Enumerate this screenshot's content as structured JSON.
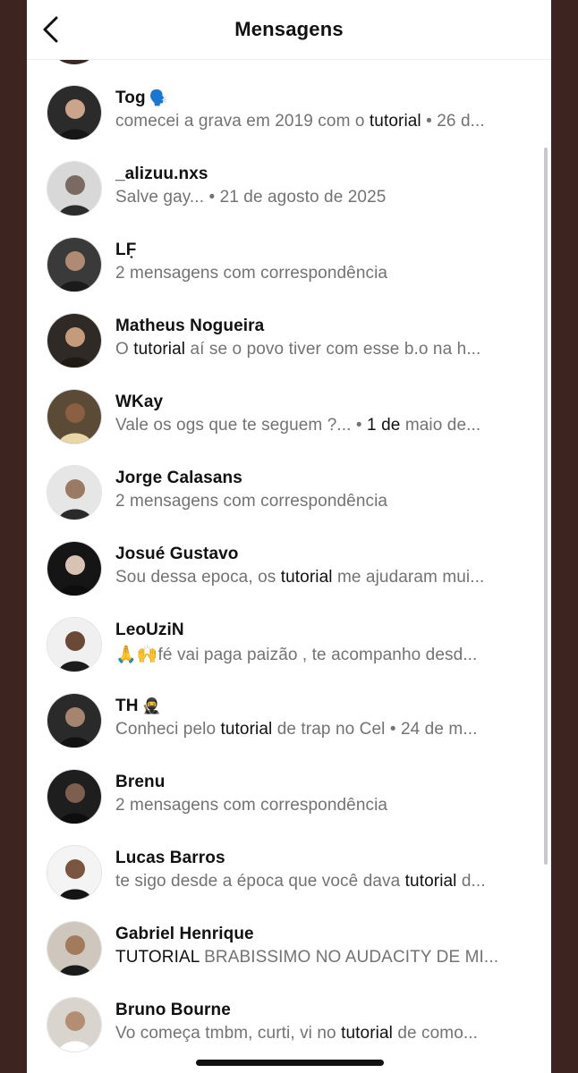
{
  "header": {
    "title": "Mensagens",
    "back_icon": "chevron-left-icon"
  },
  "conversations": [
    {
      "name": "Tog",
      "name_emoji": "🗣️",
      "preview": [
        {
          "t": "comecei a grava em 2019 com o ",
          "h": false
        },
        {
          "t": "tutorial",
          "h": true
        },
        {
          "t": " • 26 d...",
          "h": false
        }
      ]
    },
    {
      "name": "_alizuu.nxs",
      "name_emoji": "",
      "preview": [
        {
          "t": "Salve gay... • 21 de agosto de 2025",
          "h": false
        }
      ]
    },
    {
      "name": "LF̣",
      "name_emoji": "",
      "preview": [
        {
          "t": "2 mensagens com correspondência",
          "h": false
        }
      ]
    },
    {
      "name": "Matheus Nogueira",
      "name_emoji": "",
      "preview": [
        {
          "t": "O ",
          "h": false
        },
        {
          "t": "tutorial",
          "h": true
        },
        {
          "t": " aí se o povo tiver com esse b.o na h...",
          "h": false
        }
      ]
    },
    {
      "name": "WKay",
      "name_emoji": "",
      "preview": [
        {
          "t": "Vale os ogs que te seguem ?... • ",
          "h": false
        },
        {
          "t": "1 de",
          "h": true
        },
        {
          "t": " maio de...",
          "h": false
        }
      ]
    },
    {
      "name": "Jorge Calasans",
      "name_emoji": "",
      "preview": [
        {
          "t": "2 mensagens com correspondência",
          "h": false
        }
      ]
    },
    {
      "name": "Josué Gustavo",
      "name_emoji": "",
      "preview": [
        {
          "t": "Sou dessa epoca, os ",
          "h": false
        },
        {
          "t": "tutorial",
          "h": true
        },
        {
          "t": " me ajudaram mui...",
          "h": false
        }
      ]
    },
    {
      "name": "LeoUziN",
      "name_emoji": "",
      "preview": [
        {
          "t": "🙏🙌fé vai paga paizão , te acompanho desd...",
          "h": false
        }
      ]
    },
    {
      "name": "TH",
      "name_emoji": "🥷",
      "preview": [
        {
          "t": "Conheci pelo ",
          "h": false
        },
        {
          "t": "tutorial",
          "h": true
        },
        {
          "t": " de trap no Cel • 24 de m...",
          "h": false
        }
      ]
    },
    {
      "name": "Brenu",
      "name_emoji": "",
      "preview": [
        {
          "t": "2 mensagens com correspondência",
          "h": false
        }
      ]
    },
    {
      "name": "Lucas Barros",
      "name_emoji": "",
      "preview": [
        {
          "t": "te sigo desde a época que você dava ",
          "h": false
        },
        {
          "t": "tutorial",
          "h": true
        },
        {
          "t": " d...",
          "h": false
        }
      ]
    },
    {
      "name": "Gabriel Henrique",
      "name_emoji": "",
      "preview": [
        {
          "t": "TUTORIAL",
          "h": true
        },
        {
          "t": " BRABISSIMO NO AUDACITY DE MI...",
          "h": false
        }
      ]
    },
    {
      "name": "Bruno Bourne",
      "name_emoji": "",
      "preview": [
        {
          "t": "Vo começa tmbm, curti, vi no ",
          "h": false
        },
        {
          "t": "tutorial",
          "h": true
        },
        {
          "t": " de como...",
          "h": false
        }
      ]
    }
  ],
  "colors": {
    "background_frame": "#3d2420",
    "text_primary": "#111111",
    "text_secondary": "#737373"
  }
}
